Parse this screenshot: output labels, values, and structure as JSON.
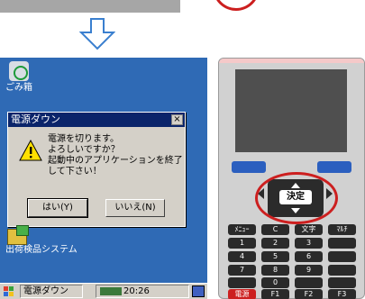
{
  "colors": {
    "desktop": "#2f6ab5",
    "dialog_title": "#0a246a",
    "highlight_red": "#cc1f1f",
    "device_body": "#d1d1d1",
    "nav_blue": "#2b5fbf"
  },
  "desktop": {
    "icons": [
      {
        "label": "ごみ箱",
        "icon": "recycle-bin-icon"
      },
      {
        "label": "出荷検品システム",
        "icon": "shipping-app-icon"
      }
    ]
  },
  "dialog": {
    "title": "電源ダウン",
    "close_symbol": "×",
    "message": "電源を切ります。\nよろしいですか？\n起動中のアプリケーションを終了\nして下さい！",
    "yes_label": "はい(Y)",
    "no_label": "いいえ(N)",
    "icon": "warning-icon"
  },
  "taskbar": {
    "task_label": "電源ダウン",
    "time": "20:26"
  },
  "device": {
    "enter_label": "決定",
    "keys": [
      [
        "ﾒﾆｭｰ",
        "C",
        "文字",
        "ﾏﾙﾁ"
      ],
      [
        "1",
        "2",
        "3",
        ""
      ],
      [
        "4",
        "5",
        "6",
        ""
      ],
      [
        "7",
        "8",
        "9",
        ""
      ],
      [
        "",
        "0",
        "",
        ""
      ],
      [
        "電源",
        "F1",
        "F2",
        "F3"
      ]
    ]
  }
}
